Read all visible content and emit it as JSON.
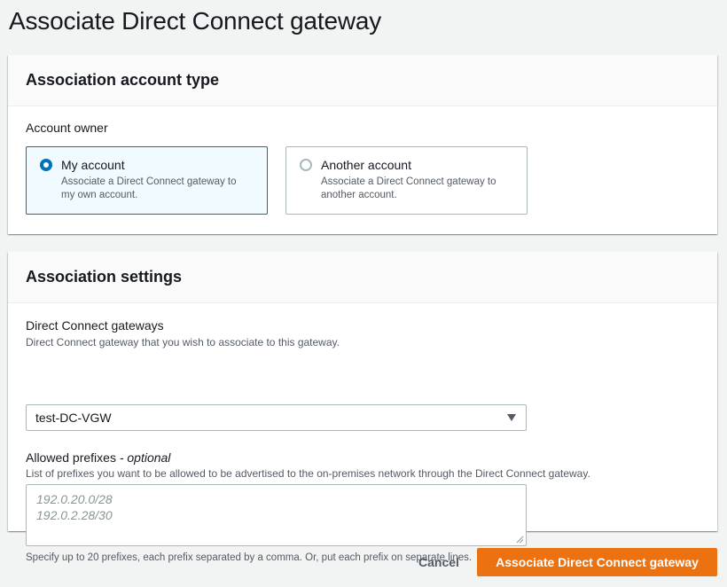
{
  "page": {
    "title": "Associate Direct Connect gateway"
  },
  "account_type": {
    "header": "Association account type",
    "field_label": "Account owner",
    "options": [
      {
        "title": "My account",
        "description": "Associate a Direct Connect gateway to my own account.",
        "selected": true
      },
      {
        "title": "Another account",
        "description": "Associate a Direct Connect gateway to another account.",
        "selected": false
      }
    ]
  },
  "settings": {
    "header": "Association settings",
    "gateways": {
      "label": "Direct Connect gateways",
      "description": "Direct Connect gateway that you wish to associate to this gateway.",
      "value": "test-DC-VGW"
    },
    "prefixes": {
      "label": "Allowed prefixes",
      "label_suffix": " - optional",
      "description": "List of prefixes you want to be allowed to be advertised to the on-premises network through the Direct Connect gateway.",
      "placeholder_lines": [
        "192.0.20.0/28",
        "192.0.2.28/30"
      ],
      "hint": "Specify up to 20 prefixes, each prefix separated by a comma. Or, put each prefix on separate lines."
    }
  },
  "actions": {
    "cancel_label": "Cancel",
    "submit_label": "Associate Direct Connect gateway"
  },
  "colors": {
    "accent": "#0073bb",
    "primary_button": "#ec7211"
  }
}
